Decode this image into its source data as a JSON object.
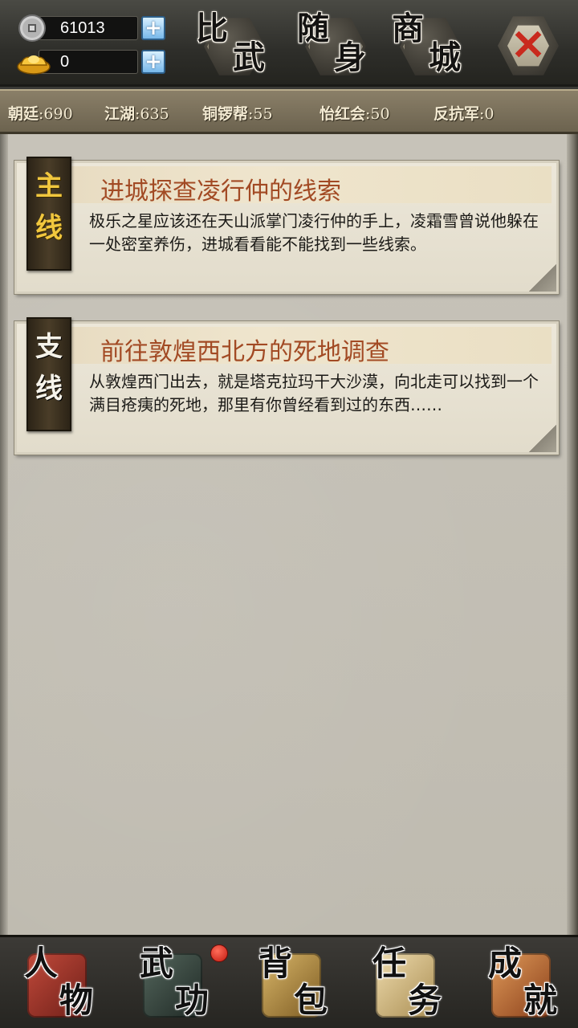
{
  "header": {
    "currencies": [
      {
        "icon": "silver-coin-icon",
        "value": "61013"
      },
      {
        "icon": "gold-ingot-icon",
        "value": "0"
      }
    ],
    "buttons": [
      {
        "name": "pvp",
        "c1": "比",
        "c2": "武"
      },
      {
        "name": "carry",
        "c1": "随",
        "c2": "身"
      },
      {
        "name": "shop",
        "c1": "商",
        "c2": "城"
      }
    ],
    "close_icon": "close-icon"
  },
  "factions": [
    {
      "name": "朝廷",
      "sep": ":",
      "value": "690"
    },
    {
      "name": "江湖",
      "sep": ":",
      "value": "635"
    },
    {
      "name": "铜锣帮",
      "sep": ":",
      "value": "55"
    },
    {
      "name": "怡红会",
      "sep": ":",
      "value": "50"
    },
    {
      "name": "反抗军",
      "sep": ":",
      "value": "0"
    }
  ],
  "quests": [
    {
      "tag_1": "主",
      "tag_2": "线",
      "title": "进城探查凌行仲的线索",
      "description": "极乐之星应该还在天山派掌门凌行仲的手上，凌霜雪曾说他躲在一处密室养伤，进城看看能不能找到一些线索。"
    },
    {
      "tag_1": "支",
      "tag_2": "线",
      "title": "前往敦煌西北方的死地调查",
      "description": "从敦煌西门出去，就是塔克拉玛干大沙漠，向北走可以找到一个满目疮痍的死地，那里有你曾经看到过的东西……"
    }
  ],
  "nav": [
    {
      "c1": "人",
      "c2": "物",
      "art_color": "#a0342a",
      "badge": false
    },
    {
      "c1": "武",
      "c2": "功",
      "art_color": "#3b4a42",
      "badge": true
    },
    {
      "c1": "背",
      "c2": "包",
      "art_color": "#b8954a",
      "badge": false
    },
    {
      "c1": "任",
      "c2": "务",
      "art_color": "#d9c08a",
      "badge": false
    },
    {
      "c1": "成",
      "c2": "就",
      "art_color": "#c97a3c",
      "badge": false
    }
  ],
  "colors": {
    "quest_title": "#a24a24",
    "main_tag_text": "#f1c73e",
    "badge_red": "#c21a10"
  }
}
